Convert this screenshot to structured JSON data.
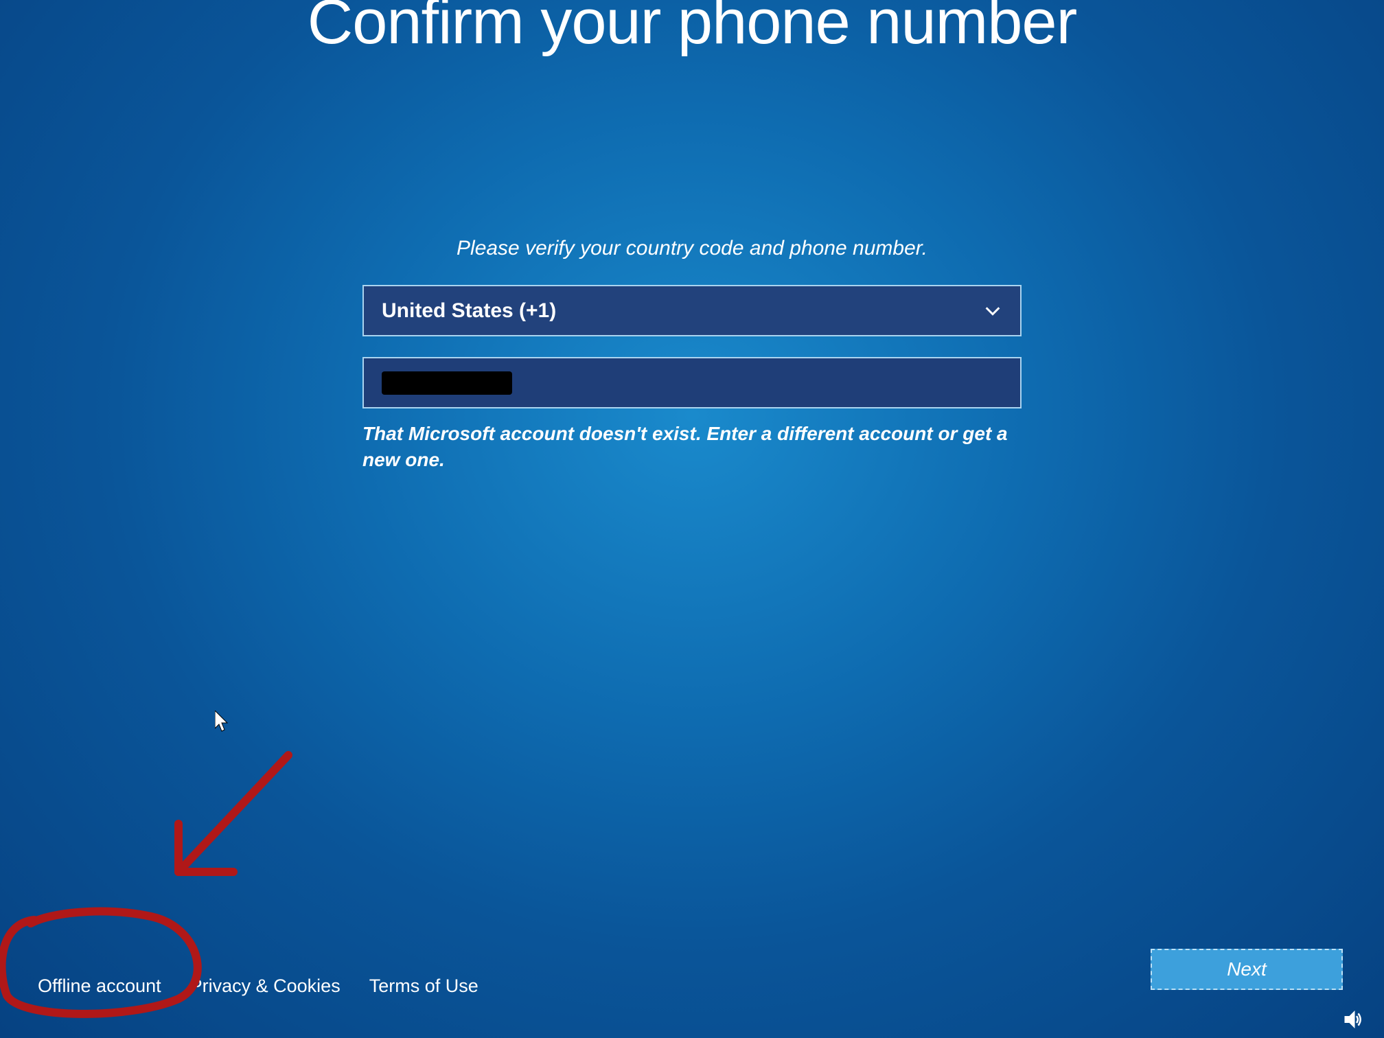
{
  "title": "Confirm your phone number",
  "instruction": "Please verify your country code and phone number.",
  "country_select": {
    "value": "United States (+1)"
  },
  "phone_input": {
    "value": ""
  },
  "error": "That Microsoft account doesn't exist. Enter a different account or get a new one.",
  "links": {
    "offline": "Offline account",
    "privacy": "Privacy & Cookies",
    "terms": "Terms of Use"
  },
  "next_button": "Next"
}
